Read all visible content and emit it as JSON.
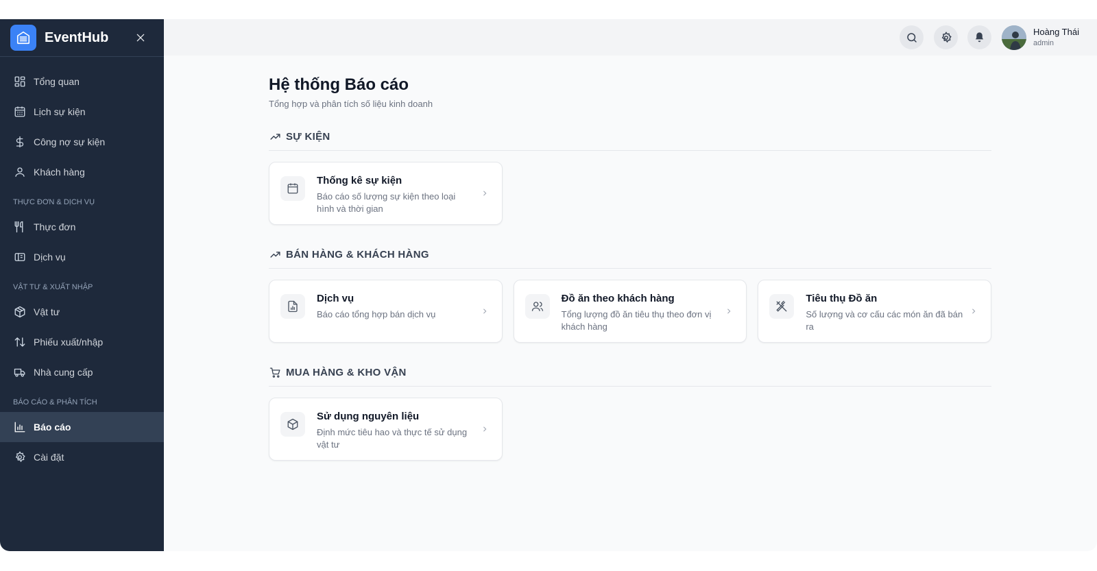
{
  "app": {
    "brand": "EventHub"
  },
  "sidebar": {
    "items": [
      {
        "label": "Tổng quan",
        "icon": "layout-grid-icon"
      },
      {
        "label": "Lịch sự kiện",
        "icon": "calendar-icon"
      },
      {
        "label": "Công nợ sự kiện",
        "icon": "dollar-icon"
      },
      {
        "label": "Khách hàng",
        "icon": "user-icon"
      }
    ],
    "section_menu": "THỰC ĐƠN & DỊCH VỤ",
    "menu_items": [
      {
        "label": "Thực đơn",
        "icon": "utensils-icon"
      },
      {
        "label": "Dịch vụ",
        "icon": "service-icon"
      }
    ],
    "section_supply": "VẬT TƯ & XUẤT NHẬP",
    "supply_items": [
      {
        "label": "Vật tư",
        "icon": "package-icon"
      },
      {
        "label": "Phiếu xuất/nhập",
        "icon": "arrows-up-down-icon"
      },
      {
        "label": "Nhà cung cấp",
        "icon": "truck-icon"
      }
    ],
    "section_report": "BÁO CÁO & PHÂN TÍCH",
    "report_items": [
      {
        "label": "Báo cáo",
        "icon": "bar-chart-icon",
        "active": true
      },
      {
        "label": "Cài đặt",
        "icon": "gear-icon"
      }
    ]
  },
  "user": {
    "name": "Hoàng Thái",
    "role": "admin"
  },
  "page": {
    "title": "Hệ thống Báo cáo",
    "subtitle": "Tổng hợp và phân tích số liệu kinh doanh"
  },
  "sections": [
    {
      "title": "SỰ KIỆN",
      "icon": "trending-up-icon",
      "cards": [
        {
          "title": "Thống kê sự kiện",
          "desc": "Báo cáo số lượng sự kiện theo loại hình và thời gian",
          "icon": "calendar-icon"
        }
      ]
    },
    {
      "title": "BÁN HÀNG & KHÁCH HÀNG",
      "icon": "trending-up-icon",
      "cards": [
        {
          "title": "Dịch vụ",
          "desc": "Báo cáo tổng hợp bán dịch vụ",
          "icon": "file-chart-icon"
        },
        {
          "title": "Đồ ăn theo khách hàng",
          "desc": "Tổng lượng đồ ăn tiêu thụ theo đơn vị khách hàng",
          "icon": "users-icon"
        },
        {
          "title": "Tiêu thụ Đồ ăn",
          "desc": "Số lượng và cơ cấu các món ăn đã bán ra",
          "icon": "utensils-crossed-icon"
        }
      ]
    },
    {
      "title": "MUA HÀNG & KHO VẬN",
      "icon": "cart-icon",
      "cards": [
        {
          "title": "Sử dụng nguyên liệu",
          "desc": "Định mức tiêu hao và thực tế sử dụng vật tư",
          "icon": "package-icon"
        }
      ]
    }
  ],
  "colors": {
    "sidebar_bg": "#1e293b",
    "accent": "#3b82f6",
    "active_bg": "#334155"
  }
}
